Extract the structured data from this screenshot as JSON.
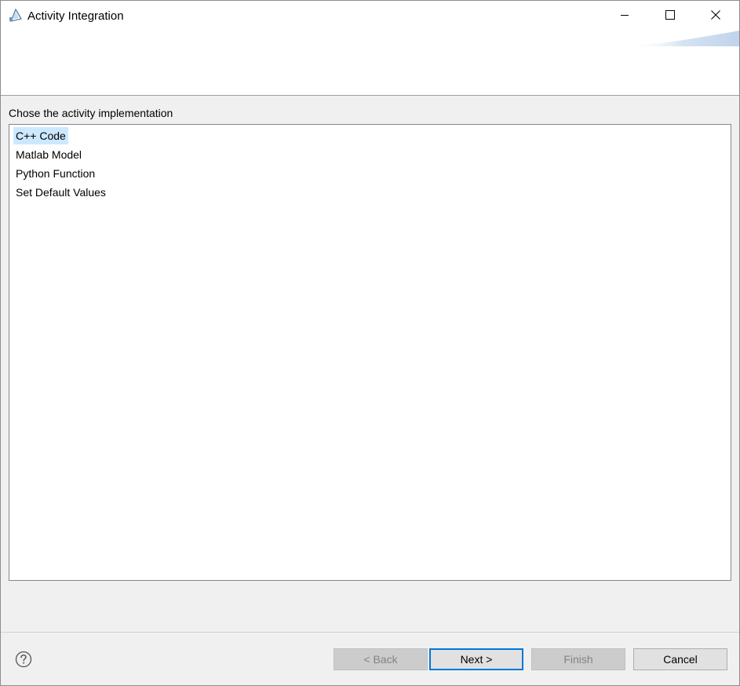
{
  "window": {
    "title": "Activity Integration",
    "app_icon": "wizard-app-icon"
  },
  "title_controls": {
    "minimize_icon": "minimize-icon",
    "maximize_icon": "maximize-icon",
    "close_icon": "close-icon"
  },
  "page": {
    "prompt": "Chose the activity implementation",
    "items": [
      {
        "label": "C++ Code",
        "selected": true
      },
      {
        "label": "Matlab Model",
        "selected": false
      },
      {
        "label": "Python Function",
        "selected": false
      },
      {
        "label": "Set Default Values",
        "selected": false
      }
    ]
  },
  "buttons": {
    "help_icon": "help-icon",
    "back": "< Back",
    "next": "Next >",
    "finish": "Finish",
    "cancel": "Cancel"
  },
  "colors": {
    "selection": "#cce8ff",
    "default_button_border": "#0078d7",
    "disabled_button_text": "#838383"
  }
}
